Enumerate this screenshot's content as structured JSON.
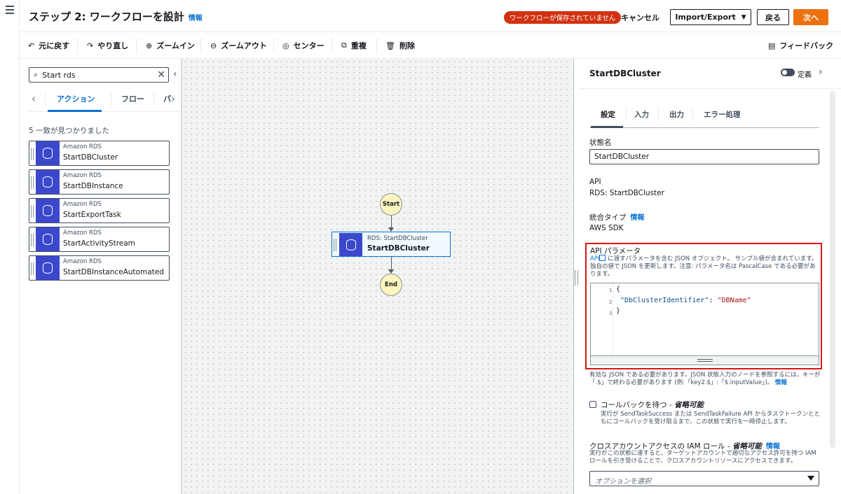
{
  "header": {
    "title": "ステップ 2: ワークフローを設計",
    "info": "情報",
    "unsaved_badge": "ワークフローが保存されていません",
    "cancel": "キャンセル",
    "import_export": "Import/Export",
    "back": "戻る",
    "next": "次へ"
  },
  "toolbar": {
    "undo": "元に戻す",
    "redo": "やり直し",
    "zoom_in": "ズームイン",
    "zoom_out": "ズームアウト",
    "center": "センター",
    "duplicate": "重複",
    "delete": "削除",
    "feedback": "フィードバック"
  },
  "left_panel": {
    "search_value": "Start rds",
    "tabs": [
      "アクション",
      "フロー",
      "パ"
    ],
    "active_tab": "アクション",
    "match_count": "5 一致が見つかりました",
    "actions": [
      {
        "service": "Amazon RDS",
        "name": "StartDBCluster"
      },
      {
        "service": "Amazon RDS",
        "name": "StartDBInstance"
      },
      {
        "service": "Amazon RDS",
        "name": "StartExportTask"
      },
      {
        "service": "Amazon RDS",
        "name": "StartActivityStream"
      },
      {
        "service": "Amazon RDS",
        "name": "StartDBInstanceAutomated…"
      }
    ]
  },
  "canvas": {
    "start": "Start",
    "end": "End",
    "task_sub": "RDS: StartDBCluster",
    "task_name": "StartDBCluster"
  },
  "right_panel": {
    "title": "StartDBCluster",
    "definition_toggle": "定義",
    "tabs": [
      "設定",
      "入力",
      "出力",
      "エラー処理"
    ],
    "state_name_label": "状態名",
    "state_name_value": "StartDBCluster",
    "api_label": "API",
    "api_value": "RDS: StartDBCluster",
    "integration_label": "統合タイプ",
    "integration_info": "情報",
    "integration_value": "AWS SDK",
    "params_label": "API パラメータ",
    "params_desc_link": "API",
    "params_desc": " に渡すパラメータを含む JSON オブジェクト。 サンプル値が含まれています。独自の値で JSON を更新します。注意: パラメータ名は PascalCase である必要があります。",
    "code_lines": [
      "1",
      "2",
      "3"
    ],
    "code_open": "{",
    "code_key": "\"DbClusterIdentifier\"",
    "code_colon": ": ",
    "code_value": "\"DBName\"",
    "code_close": "}",
    "json_note": "有効な JSON である必要があります。JSON 状態入力のノードを参照するには、キーが「.$」で終わる必要があります (例:「key2.$」:「$.inputValue」)。",
    "json_note_info": "情報",
    "callback_label": "コールバックを待つ - ",
    "callback_optional": "省略可能",
    "callback_desc": "実行が SendTaskSuccess または SendTaskFailure API からタスクトークンとともにコールバックを受け取るまで、この状態で実行を一時停止します。",
    "iam_label": "クロスアカウントアクセスの IAM ロール - ",
    "iam_optional": "省略可能",
    "iam_info": "情報",
    "iam_desc": "実行がこの状態に達すると、ターゲットアカウントで適切なアクセス許可を持つ IAM ロールを引き受けることで、クロスアカウントリソースにアクセスできます。",
    "iam_placeholder": "オプションを選択"
  }
}
